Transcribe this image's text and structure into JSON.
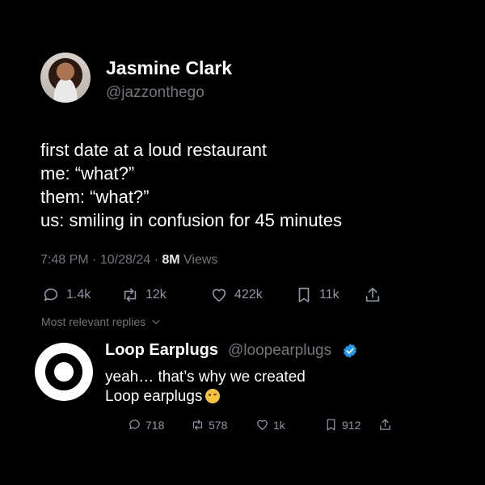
{
  "tweet": {
    "author_name": "Jasmine Clark",
    "author_handle": "@jazzonthego",
    "lines": [
      "first date at a loud restaurant",
      "me: “what?”",
      "them: “what?”",
      "us: smiling in confusion for 45 minutes"
    ],
    "time": "7:48 PM",
    "date": "10/28/24",
    "separator": "·",
    "views_count": "8M",
    "views_label": "Views",
    "stats": {
      "replies": "1.4k",
      "reposts": "12k",
      "likes": "422k",
      "bookmarks": "11k"
    }
  },
  "replies_filter": {
    "label": "Most relevant replies"
  },
  "reply": {
    "author_name": "Loop Earplugs",
    "author_handle": "@loopearplugs",
    "verified_color": "#1d9bf0",
    "lines": [
      "yeah… that’s why we created",
      "Loop earplugs"
    ],
    "emoji": "winking-face",
    "stats": {
      "replies": "718",
      "reposts": "578",
      "likes": "1k",
      "bookmarks": "912"
    }
  },
  "icons": {
    "reply": "reply-icon",
    "repost": "repost-icon",
    "like": "heart-icon",
    "bookmark": "bookmark-icon",
    "share": "share-icon",
    "chevron": "chevron-down-icon",
    "verified": "verified-badge-icon"
  }
}
